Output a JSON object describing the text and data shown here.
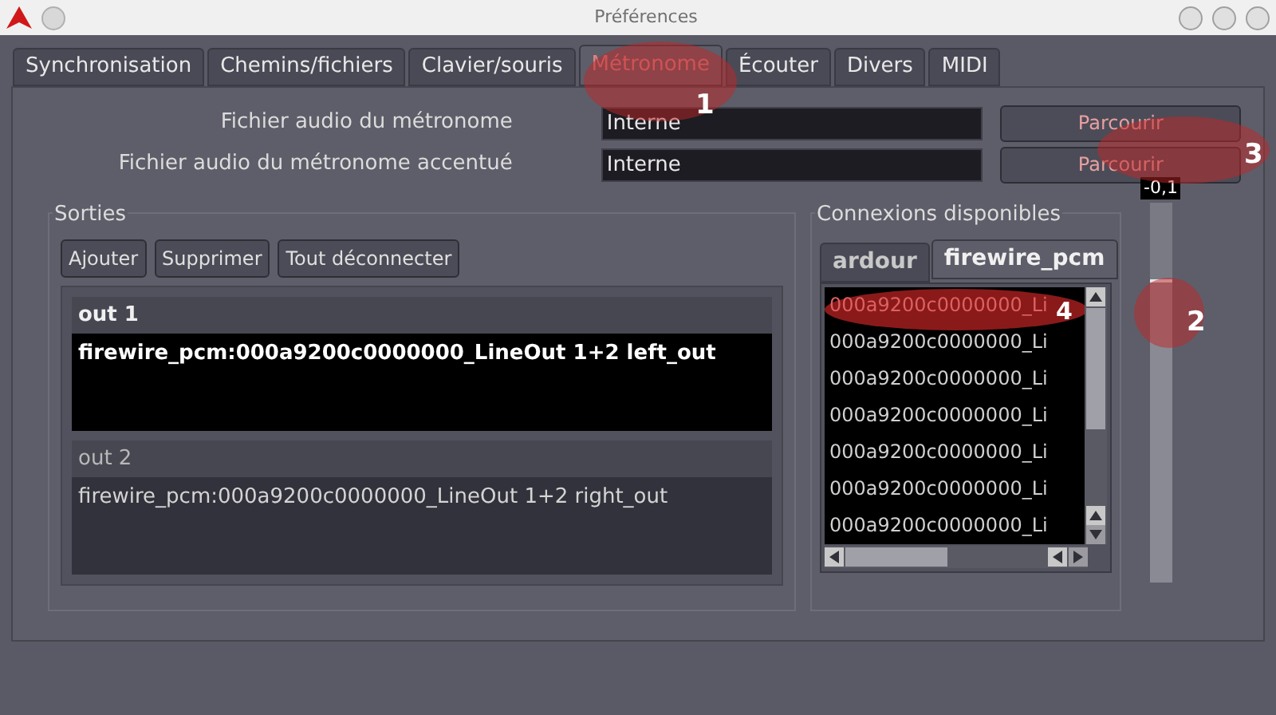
{
  "window": {
    "title": "Préférences"
  },
  "tabs": [
    {
      "label": "Synchronisation",
      "selected": false
    },
    {
      "label": "Chemins/fichiers",
      "selected": false
    },
    {
      "label": "Clavier/souris",
      "selected": false
    },
    {
      "label": "Métronome",
      "selected": true
    },
    {
      "label": "Écouter",
      "selected": false
    },
    {
      "label": "Divers",
      "selected": false
    },
    {
      "label": "MIDI",
      "selected": false
    }
  ],
  "files": [
    {
      "label": "Fichier audio du métronome",
      "value": "Interne",
      "button": "Parcourir"
    },
    {
      "label": "Fichier audio du métronome accentué",
      "value": "Interne",
      "button": "Parcourir"
    }
  ],
  "outputs": {
    "title": "Sorties",
    "buttons": [
      "Ajouter",
      "Supprimer",
      "Tout déconnecter"
    ],
    "ports": [
      {
        "name": "out 1",
        "selected": true,
        "connection": "firewire_pcm:000a9200c0000000_LineOut 1+2 left_out"
      },
      {
        "name": "out 2",
        "selected": false,
        "connection": "firewire_pcm:000a9200c0000000_LineOut 1+2 right_out"
      }
    ]
  },
  "connections": {
    "title": "Connexions disponibles",
    "tabs": [
      {
        "label": "ardour",
        "selected": false
      },
      {
        "label": "firewire_pcm",
        "selected": true
      }
    ],
    "items": [
      {
        "label": "000a9200c0000000_Li",
        "connected": true
      },
      {
        "label": "000a9200c0000000_Li",
        "connected": false
      },
      {
        "label": "000a9200c0000000_Li",
        "connected": false
      },
      {
        "label": "000a9200c0000000_Li",
        "connected": false
      },
      {
        "label": "000a9200c0000000_Li",
        "connected": false
      },
      {
        "label": "000a9200c0000000_Li",
        "connected": false
      },
      {
        "label": "000a9200c0000000_Li",
        "connected": false
      }
    ]
  },
  "fader": {
    "reading": "-0,1",
    "level": 0.8
  },
  "annotations": [
    "1",
    "2",
    "3",
    "4"
  ]
}
